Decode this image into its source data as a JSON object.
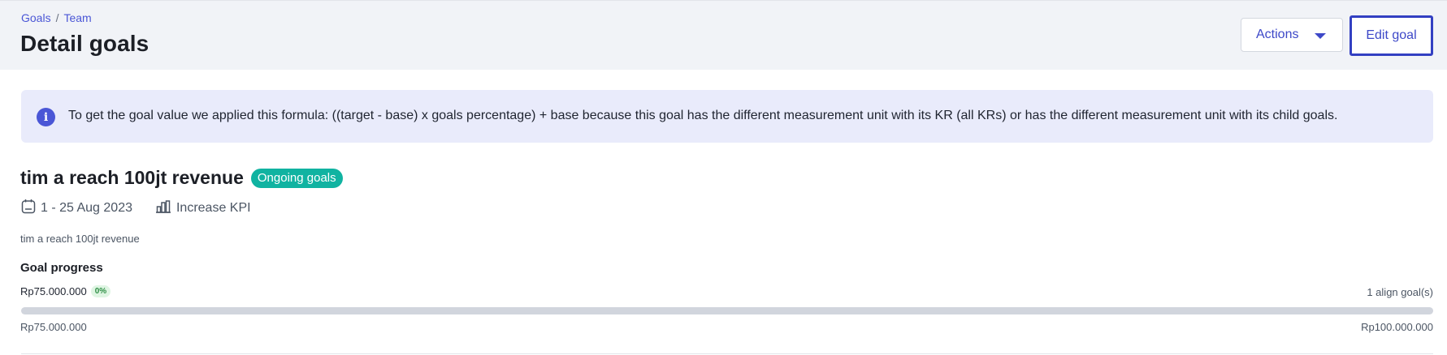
{
  "header": {
    "breadcrumb": [
      "Goals",
      "Team"
    ],
    "breadcrumb_sep": "/",
    "title": "Detail goals",
    "actions_label": "Actions",
    "edit_label": "Edit goal"
  },
  "info": {
    "icon": "info-icon",
    "icon_glyph": "i",
    "text": "To get the goal value we applied this formula: ((target - base) x goals percentage) + base because this goal has the different measurement unit with its KR (all KRs) or has the different measurement unit with its child goals."
  },
  "goal": {
    "name": "tim a reach 100jt revenue",
    "status": "Ongoing goals",
    "status_color": "#10b3a1",
    "date_range": "1 - 25 Aug 2023",
    "date_icon": "calendar-icon",
    "kpi_type": "Increase KPI",
    "kpi_icon": "bar-chart-icon",
    "description": "tim a reach 100jt revenue"
  },
  "progress": {
    "heading": "Goal progress",
    "current_value": "Rp75.000.000",
    "percentage": "0%",
    "percentage_value": 0,
    "align_goals": "1 align goal(s)",
    "min_value": "Rp75.000.000",
    "max_value": "Rp100.000.000"
  },
  "colors": {
    "accent": "#4a56d6",
    "banner_bg": "#e9ebfb",
    "header_bg": "#f1f3f7"
  }
}
